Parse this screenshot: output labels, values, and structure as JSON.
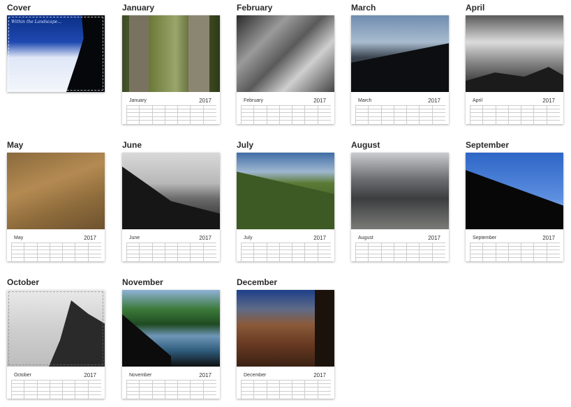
{
  "year": "2017",
  "cover": {
    "title": "Cover",
    "tagline": "Within the Landscape..."
  },
  "months": [
    {
      "title": "January",
      "label": "January"
    },
    {
      "title": "February",
      "label": "February"
    },
    {
      "title": "March",
      "label": "March"
    },
    {
      "title": "April",
      "label": "April"
    },
    {
      "title": "May",
      "label": "May"
    },
    {
      "title": "June",
      "label": "June"
    },
    {
      "title": "July",
      "label": "July"
    },
    {
      "title": "August",
      "label": "August"
    },
    {
      "title": "September",
      "label": "September"
    },
    {
      "title": "October",
      "label": "October"
    },
    {
      "title": "November",
      "label": "November"
    },
    {
      "title": "December",
      "label": "December"
    }
  ]
}
